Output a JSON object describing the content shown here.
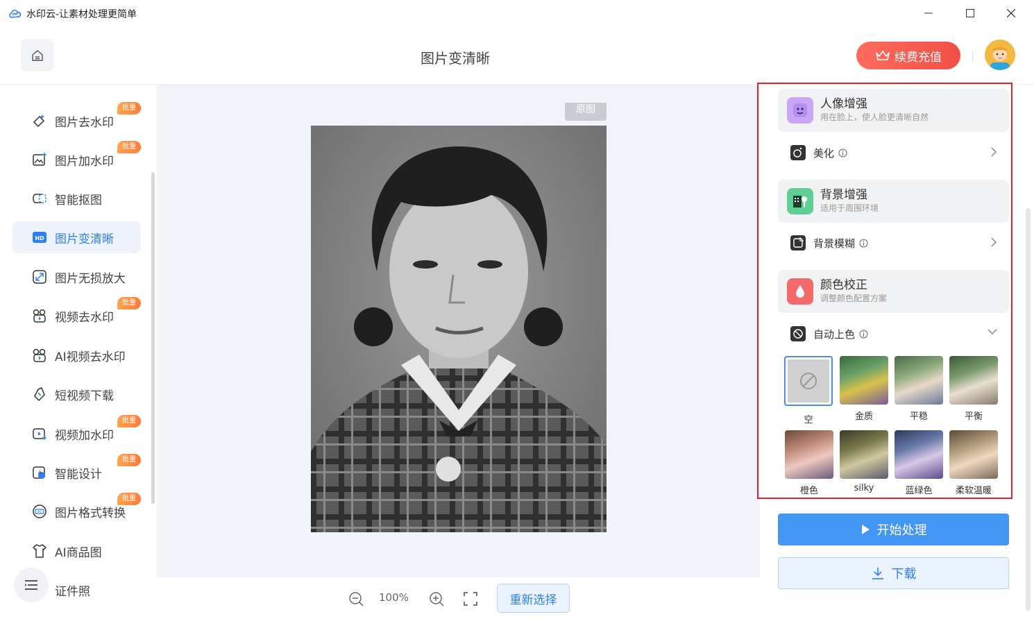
{
  "window": {
    "title": "水印云-让素材处理更简单",
    "minimize_icon": "minimize-icon",
    "maximize_icon": "maximize-icon",
    "close_icon": "close-icon"
  },
  "header": {
    "page_title": "图片变清晰",
    "recharge_label": "续费充值",
    "recharge_icon": "crown-icon",
    "home_icon": "home-icon"
  },
  "sidebar": {
    "items": [
      {
        "label": "图片去水印",
        "badge": "批量",
        "icon": "eraser-icon"
      },
      {
        "label": "图片加水印",
        "badge": "批量",
        "icon": "image-add-icon"
      },
      {
        "label": "智能抠图",
        "badge": "",
        "icon": "cutout-icon"
      },
      {
        "label": "图片变清晰",
        "badge": "",
        "icon": "hd-icon"
      },
      {
        "label": "图片无损放大",
        "badge": "",
        "icon": "expand-icon"
      },
      {
        "label": "视频去水印",
        "badge": "批量",
        "icon": "video-eraser-icon"
      },
      {
        "label": "AI视频去水印",
        "badge": "",
        "icon": "ai-video-icon"
      },
      {
        "label": "短视频下载",
        "badge": "",
        "icon": "link-icon"
      },
      {
        "label": "视频加水印",
        "badge": "批量",
        "icon": "video-add-icon"
      },
      {
        "label": "智能设计",
        "badge": "批量",
        "icon": "design-icon"
      },
      {
        "label": "图片格式转换",
        "badge": "批量",
        "icon": "jpg-icon"
      },
      {
        "label": "AI商品图",
        "badge": "",
        "icon": "shirt-icon"
      },
      {
        "label": "证件照",
        "badge": "",
        "icon": "id-photo-icon"
      }
    ],
    "active_index": 3,
    "menu_icon": "menu-icon"
  },
  "canvas": {
    "original_tag": "原图",
    "zoom_value": "100%",
    "reselect_label": "重新选择"
  },
  "panel": {
    "portrait": {
      "title": "人像增强",
      "subtitle": "用在脸上，使人脸更清晰自然"
    },
    "beautify": {
      "label": "美化"
    },
    "background": {
      "title": "背景增强",
      "subtitle": "适用于周围环境"
    },
    "bg_blur": {
      "label": "背景模糊"
    },
    "color": {
      "title": "颜色校正",
      "subtitle": "调整颜色配置方案"
    },
    "auto_color": {
      "label": "自动上色"
    },
    "swatches": [
      "空",
      "金质",
      "平稳",
      "平衡",
      "橙色",
      "silky",
      "蓝绿色",
      "柔软温暖"
    ],
    "selected_swatch": 0,
    "start_label": "开始处理",
    "download_label": "下载"
  },
  "colors": {
    "accent": "#2d7ff5",
    "primary_button": "#4496f5",
    "recharge": "#f24f45",
    "badge": "#ff8a3d",
    "highlight_border": "#e1242d"
  }
}
